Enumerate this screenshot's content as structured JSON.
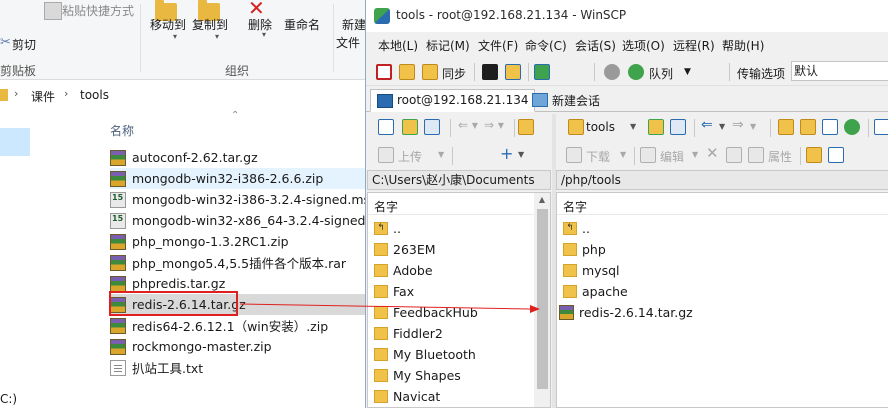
{
  "explorer": {
    "ribbon": {
      "paste_shortcut": "粘贴快捷方式",
      "cut": "剪切",
      "clipboard_group": "剪贴板",
      "move_to": "移动到",
      "copy_to": "复制到",
      "delete": "删除",
      "rename": "重命名",
      "new_trunc": "新建",
      "file_trunc": "文件",
      "organize_group": "组织"
    },
    "breadcrumb": [
      "课件",
      "tools"
    ],
    "column_name": "名称",
    "files": [
      {
        "name": "autoconf-2.62.tar.gz",
        "icon": "archive-icon"
      },
      {
        "name": "mongodb-win32-i386-2.6.6.zip",
        "icon": "archive-icon",
        "highlighted": true
      },
      {
        "name": "mongodb-win32-i386-3.2.4-signed.msi",
        "icon": "msi-icon"
      },
      {
        "name": "mongodb-win32-x86_64-3.2.4-signed...",
        "icon": "msi-icon"
      },
      {
        "name": "php_mongo-1.3.2RC1.zip",
        "icon": "archive-icon"
      },
      {
        "name": "php_mongo5.4,5.5插件各个版本.rar",
        "icon": "archive-icon"
      },
      {
        "name": "phpredis.tar.gz",
        "icon": "archive-icon"
      },
      {
        "name": "redis-2.6.14.tar.gz",
        "icon": "archive-icon",
        "selected": true
      },
      {
        "name": "redis64-2.6.12.1（win安装）.zip",
        "icon": "archive-icon"
      },
      {
        "name": "rockmongo-master.zip",
        "icon": "archive-icon"
      },
      {
        "name": "扒站工具.txt",
        "icon": "text-icon"
      }
    ],
    "drive_text": "C:)",
    "highlight_color": "#e02020"
  },
  "winscp": {
    "title": "tools - root@192.168.21.134 - WinSCP",
    "menu": [
      "本地(L)",
      "标记(M)",
      "文件(F)",
      "命令(C)",
      "会话(S)",
      "选项(O)",
      "远程(R)",
      "帮助(H)"
    ],
    "toolbar": {
      "sync": "同步",
      "queue": "队列",
      "transfer_options_label": "传输选项",
      "transfer_options_value": "默认"
    },
    "tabs": {
      "session": "root@192.168.21.134",
      "new_session": "新建会话"
    },
    "left_pane": {
      "upload": "上传",
      "path": "C:\\Users\\赵小康\\Documents",
      "column_name": "名字",
      "items": [
        "..",
        "263EM",
        "Adobe",
        "Fax",
        "FeedbackHub",
        "Fiddler2",
        "My Bluetooth",
        "My Shapes",
        "Navicat"
      ]
    },
    "right_pane": {
      "dir_select": "tools",
      "download": "下载",
      "edit": "编辑",
      "properties": "属性",
      "path": "/php/tools",
      "column_name": "名字",
      "items": [
        {
          "name": "..",
          "type": "up"
        },
        {
          "name": "php",
          "type": "folder"
        },
        {
          "name": "mysql",
          "type": "folder"
        },
        {
          "name": "apache",
          "type": "folder"
        },
        {
          "name": "redis-2.6.14.tar.gz",
          "type": "archive"
        }
      ]
    }
  }
}
